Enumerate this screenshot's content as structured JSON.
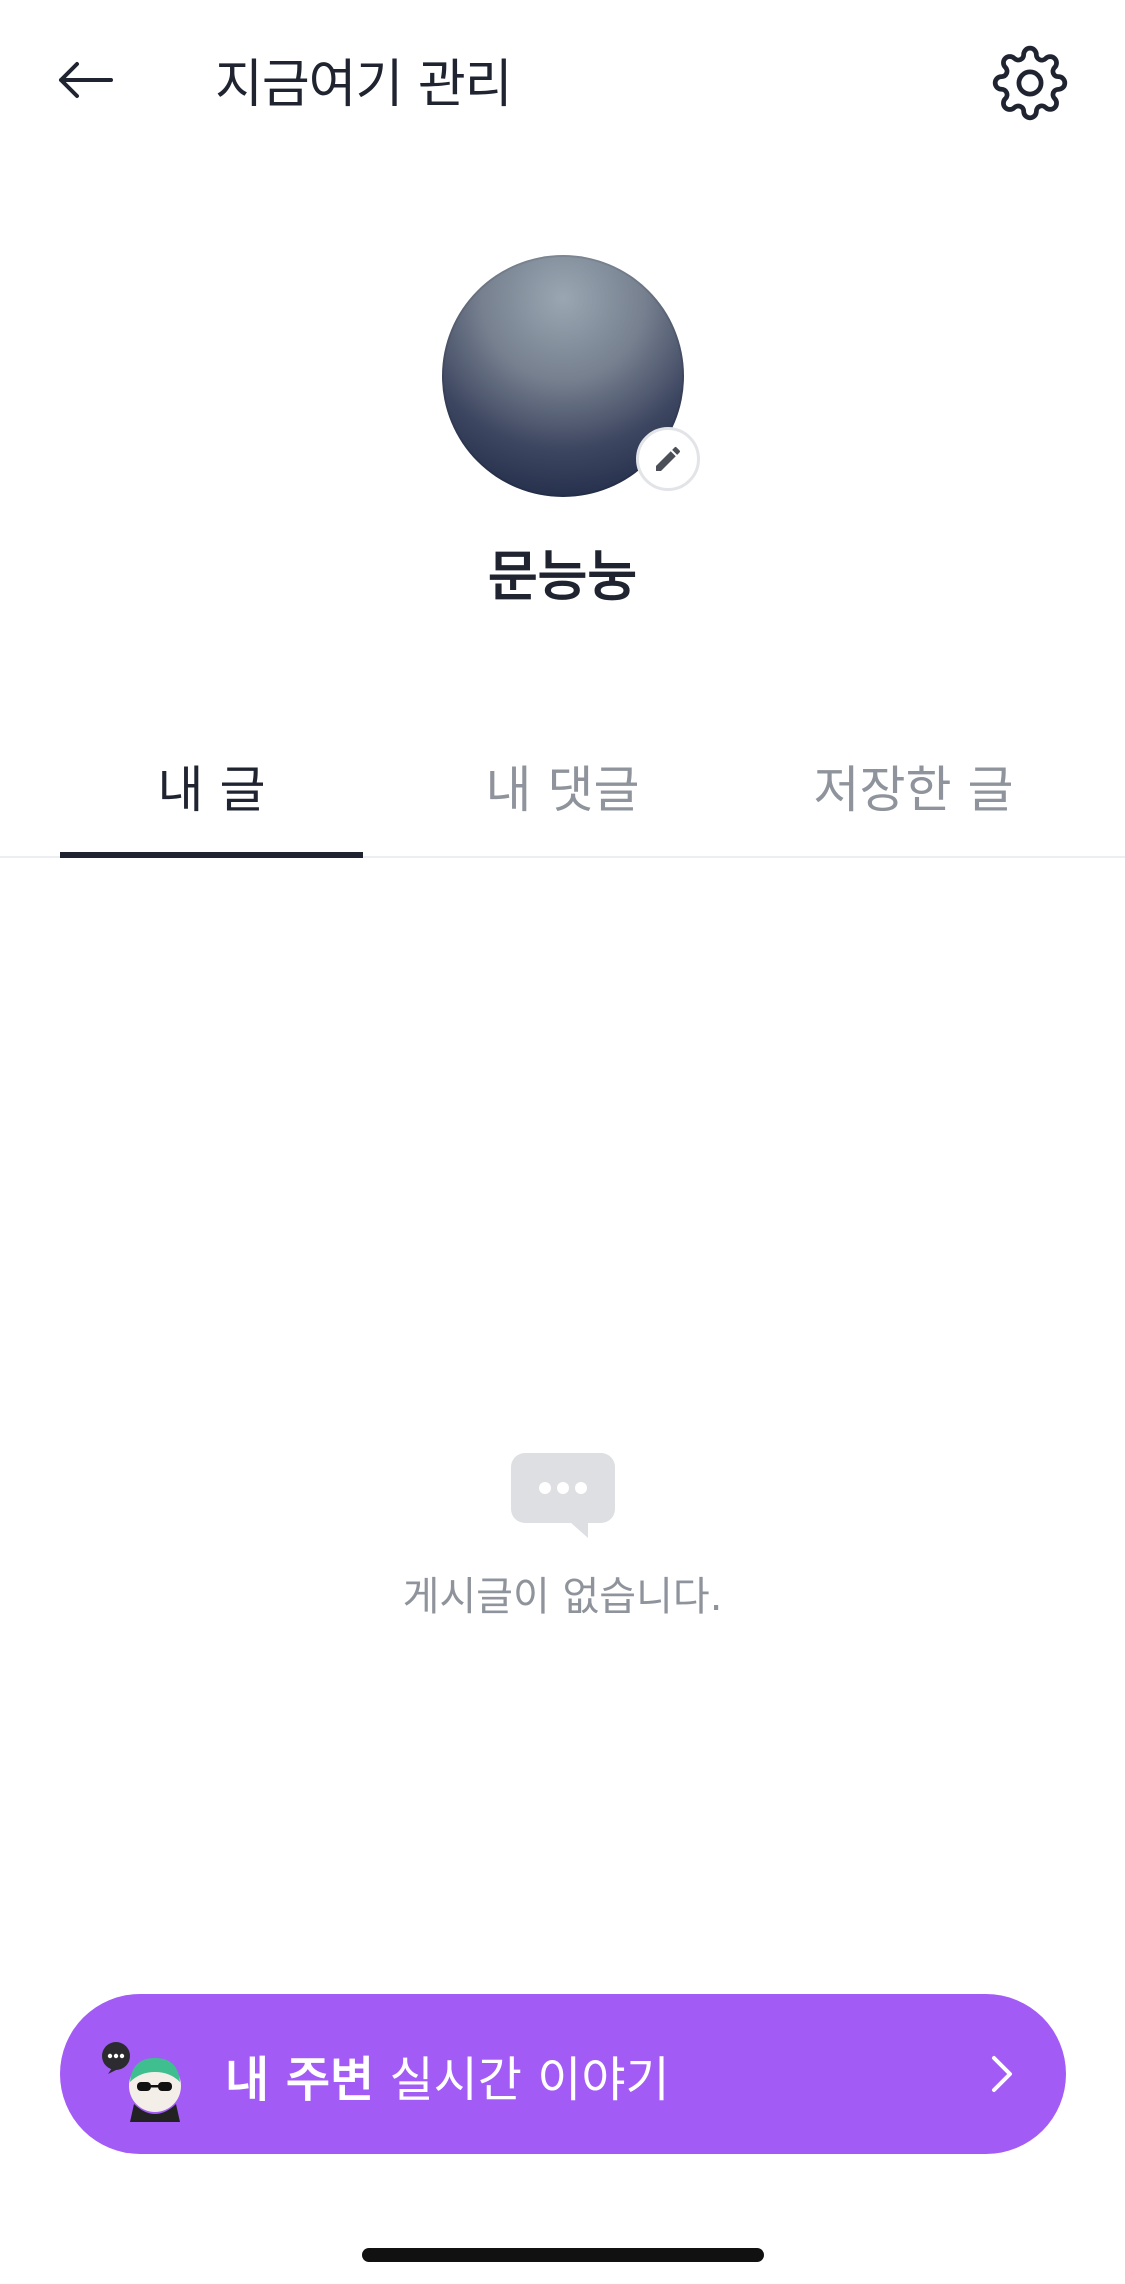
{
  "header": {
    "title": "지금여기 관리",
    "back_icon": "arrow-left-icon",
    "settings_icon": "gear-icon"
  },
  "profile": {
    "username": "문능눙",
    "edit_icon": "pencil-icon"
  },
  "tabs": [
    {
      "label": "내 글",
      "active": true
    },
    {
      "label": "내 댓글",
      "active": false
    },
    {
      "label": "저장한 글",
      "active": false
    }
  ],
  "empty_state": {
    "icon": "chat-bubble-icon",
    "message": "게시글이 없습니다."
  },
  "cta": {
    "bold_label": "내 주변",
    "label": "실시간 이야기",
    "icon": "chevron-right-icon",
    "color": "#a35bf6"
  }
}
